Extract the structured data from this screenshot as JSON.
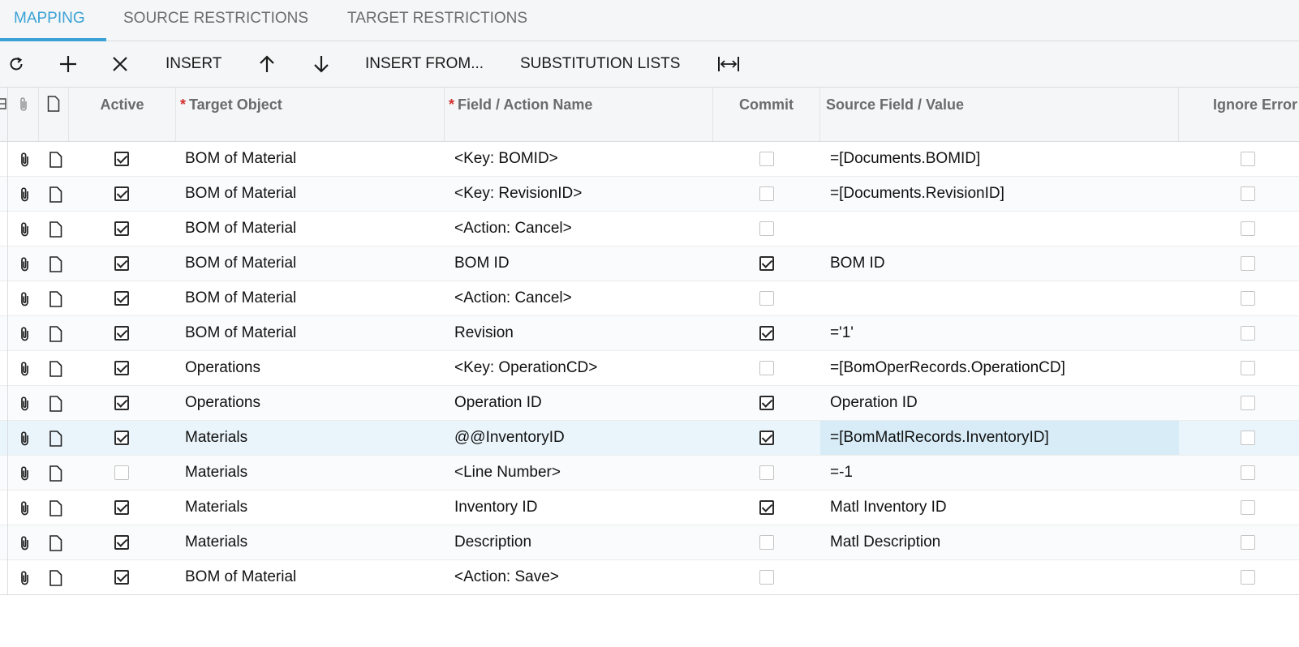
{
  "tabs": [
    {
      "label": "MAPPING",
      "active": true
    },
    {
      "label": "SOURCE RESTRICTIONS",
      "active": false
    },
    {
      "label": "TARGET RESTRICTIONS",
      "active": false
    }
  ],
  "toolbar": {
    "refresh_icon": "refresh-icon",
    "add_icon": "plus-icon",
    "delete_icon": "close-icon",
    "insert_label": "INSERT",
    "up_icon": "arrow-up-icon",
    "down_icon": "arrow-down-icon",
    "insert_from_label": "INSERT FROM...",
    "substitution_lists_label": "SUBSTITUTION LISTS",
    "fit_icon": "fit-width-icon"
  },
  "grid": {
    "columns": {
      "active": "Active",
      "target_object": "Target Object",
      "field_action": "Field / Action Name",
      "commit": "Commit",
      "source_field": "Source Field / Value",
      "ignore_error": "Ignore Error"
    },
    "rows": [
      {
        "active": true,
        "target": "BOM of Material",
        "field": "<Key: BOMID>",
        "commit": false,
        "source": "=[Documents.BOMID]",
        "ignore": false
      },
      {
        "active": true,
        "target": "BOM of Material",
        "field": "<Key: RevisionID>",
        "commit": false,
        "source": "=[Documents.RevisionID]",
        "ignore": false
      },
      {
        "active": true,
        "target": "BOM of Material",
        "field": "<Action: Cancel>",
        "commit": false,
        "source": "",
        "ignore": false
      },
      {
        "active": true,
        "target": "BOM of Material",
        "field": "BOM ID",
        "commit": true,
        "source": "BOM ID",
        "ignore": false
      },
      {
        "active": true,
        "target": "BOM of Material",
        "field": "<Action: Cancel>",
        "commit": false,
        "source": "",
        "ignore": false
      },
      {
        "active": true,
        "target": "BOM of Material",
        "field": "Revision",
        "commit": true,
        "source": "='1'",
        "ignore": false
      },
      {
        "active": true,
        "target": "Operations",
        "field": "<Key: OperationCD>",
        "commit": false,
        "source": "=[BomOperRecords.OperationCD]",
        "ignore": false
      },
      {
        "active": true,
        "target": "Operations",
        "field": "Operation ID",
        "commit": true,
        "source": "Operation ID",
        "ignore": false
      },
      {
        "active": true,
        "target": "Materials",
        "field": "@@InventoryID",
        "commit": true,
        "source": "=[BomMatlRecords.InventoryID]",
        "ignore": false,
        "selected": true
      },
      {
        "active": false,
        "target": "Materials",
        "field": "<Line Number>",
        "commit": false,
        "source": "=-1",
        "ignore": false
      },
      {
        "active": true,
        "target": "Materials",
        "field": "Inventory ID",
        "commit": true,
        "source": "Matl Inventory ID",
        "ignore": false
      },
      {
        "active": true,
        "target": "Materials",
        "field": "Description",
        "commit": false,
        "source": "Matl Description",
        "ignore": false
      },
      {
        "active": true,
        "target": "BOM of Material",
        "field": "<Action: Save>",
        "commit": false,
        "source": "",
        "ignore": false
      }
    ]
  },
  "colors": {
    "accent": "#3aa2d6",
    "required": "#d32f2f",
    "selected_row": "#eaf5fb",
    "selected_cell": "#d7ecf7"
  }
}
